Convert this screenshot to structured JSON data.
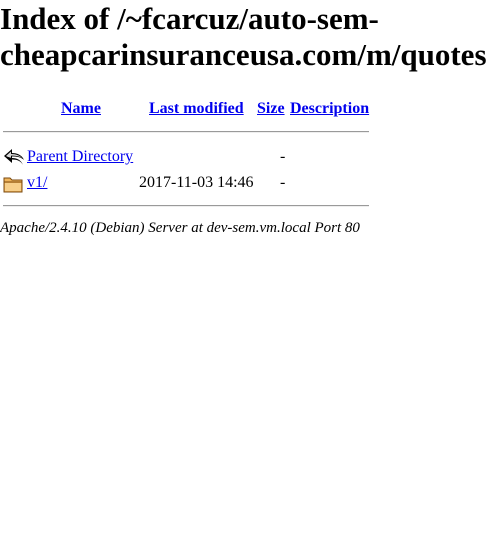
{
  "page": {
    "heading_line1": "Index of /~fcarcuz/auto-sem-",
    "heading_line2": "cheapcarinsuranceusa.com/m/quotes"
  },
  "table": {
    "headers": {
      "name": "Name",
      "last_modified": "Last modified",
      "size": "Size",
      "description": "Description"
    },
    "rows": [
      {
        "icon": "back-arrow-icon",
        "name": "Parent Directory",
        "last_modified": "",
        "size": "-",
        "description": ""
      },
      {
        "icon": "folder-icon",
        "name": "v1/",
        "last_modified": "2017-11-03 14:46",
        "size": "-",
        "description": ""
      }
    ]
  },
  "footer": {
    "text": "Apache/2.4.10 (Debian) Server at dev-sem.vm.local Port 80"
  }
}
